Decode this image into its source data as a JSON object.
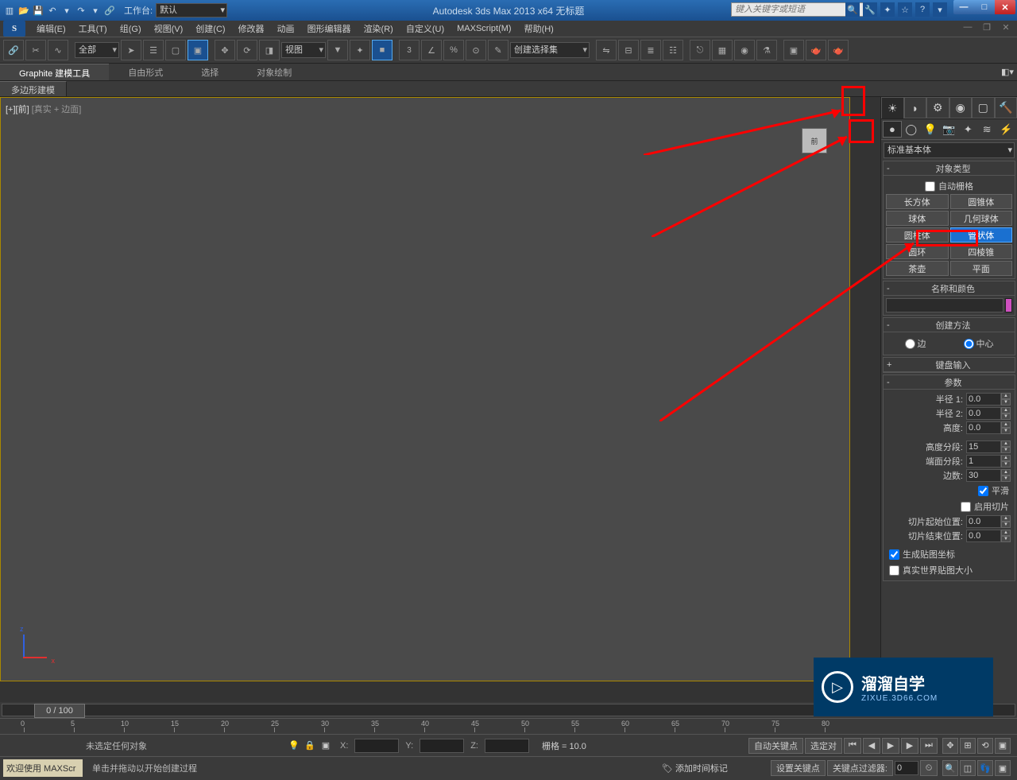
{
  "titlebar": {
    "workspace_label": "工作台:",
    "workspace_value": "默认",
    "title": "Autodesk 3ds Max  2013 x64      无标题",
    "search_placeholder": "键入关键字或短语"
  },
  "menu": [
    "编辑(E)",
    "工具(T)",
    "组(G)",
    "视图(V)",
    "创建(C)",
    "修改器",
    "动画",
    "图形编辑器",
    "渲染(R)",
    "自定义(U)",
    "MAXScript(M)",
    "帮助(H)"
  ],
  "toolbar": {
    "filter_dd": "全部",
    "view_dd": "视图",
    "selset_dd": "创建选择集"
  },
  "ribbon": {
    "tabs": [
      "Graphite 建模工具",
      "自由形式",
      "选择",
      "对象绘制"
    ],
    "active": 0
  },
  "modtab": "多边形建模",
  "viewport": {
    "label_left": "[+][前]",
    "label_right": "[真实 + 边面]",
    "cube_face": "前"
  },
  "cmdpanel": {
    "category": "标准基本体",
    "object_type_title": "对象类型",
    "autogrid": "自动栅格",
    "primitives": [
      [
        "长方体",
        "圆锥体"
      ],
      [
        "球体",
        "几何球体"
      ],
      [
        "圆柱体",
        "管状体"
      ],
      [
        "圆环",
        "四棱锥"
      ],
      [
        "茶壶",
        "平面"
      ]
    ],
    "name_color_title": "名称和颜色",
    "creation_title": "创建方法",
    "radio_edge": "边",
    "radio_center": "中心",
    "keyboard_title": "键盘输入",
    "params_title": "参数",
    "radius1": "半径 1:",
    "radius2": "半径 2:",
    "height": "高度:",
    "radius1_v": "0.0",
    "radius2_v": "0.0",
    "height_v": "0.0",
    "heightsegs": "高度分段:",
    "capsegs": "端面分段:",
    "sides": "边数:",
    "heightsegs_v": "15",
    "capsegs_v": "1",
    "sides_v": "30",
    "smooth": "平滑",
    "slice": "启用切片",
    "slice_from": "切片起始位置:",
    "slice_to": "切片结束位置:",
    "slice_from_v": "0.0",
    "slice_to_v": "0.0",
    "genmap": "生成贴图坐标",
    "realworld": "真实世界贴图大小"
  },
  "timeline": {
    "handle": "0 / 100",
    "ticks": [
      0,
      5,
      10,
      15,
      20,
      25,
      30,
      35,
      40,
      45,
      50,
      55,
      60,
      65,
      70,
      75,
      80
    ]
  },
  "status": {
    "welcome": "欢迎使用  MAXScr",
    "msg1": "未选定任何对象",
    "msg2": "单击并拖动以开始创建过程",
    "x": "X:",
    "y": "Y:",
    "z": "Z:",
    "grid": "栅格 = 10.0",
    "add_marker": "添加时间标记",
    "autokey": "自动关键点",
    "setkey": "设置关键点",
    "selset": "选定对",
    "keyfilter": "关键点过滤器:"
  },
  "watermark": {
    "big": "溜溜自学",
    "small": "ZIXUE.3D66.COM"
  }
}
